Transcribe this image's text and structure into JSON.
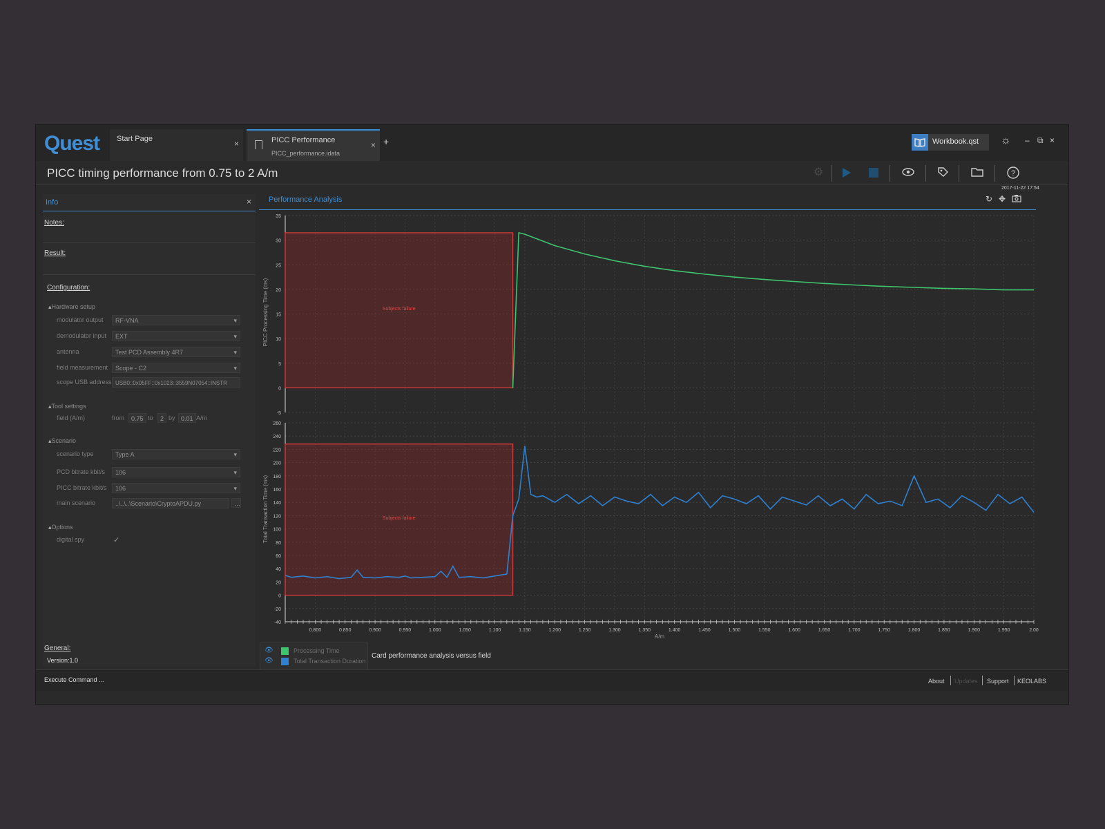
{
  "app": {
    "logo": "Quest",
    "tabs": [
      {
        "title": "Start Page",
        "subtitle": ""
      },
      {
        "title": "PICC Performance",
        "subtitle": "PICC_performance.idata"
      }
    ],
    "add_tab": "+",
    "workbook": "Workbook.qst",
    "window_controls": {
      "minimize": "–",
      "maximize": "⧉",
      "close": "×"
    },
    "close_glyph": "×"
  },
  "title": "PICC timing performance from 0.75 to 2 A/m",
  "toolbar_icons": [
    "settings-icon",
    "play-icon",
    "stop-icon",
    "eye-icon",
    "tag-icon",
    "folder-icon",
    "help-icon"
  ],
  "info": {
    "title": "Info",
    "notes": "Notes:",
    "result": "Result:",
    "configuration": "Configuration:",
    "hardware_setup": "Hardware setup",
    "modulator_output_label": "modulator output",
    "modulator_output": "RF-VNA",
    "demodulator_input_label": "demodulator input",
    "demodulator_input": "EXT",
    "antenna_label": "antenna",
    "antenna": "Test PCD Assembly 4R7",
    "field_measurement_label": "field measurement",
    "field_measurement": "Scope - C2",
    "scope_usb_label": "scope USB address",
    "scope_usb": "USB0::0x05FF::0x1023::3559N07054::INSTR",
    "tool_settings": "Tool settings",
    "field_label": "field (A/m)",
    "from_label": "from",
    "from": "0.75",
    "to_label": "to",
    "to": "2",
    "by_label": "by",
    "by": "0.01",
    "unit": "A/m",
    "scenario": "Scenario",
    "scenario_type_label": "scenario type",
    "scenario_type": "Type A",
    "pcd_bitrate_label": "PCD bitrate kbit/s",
    "pcd_bitrate": "106",
    "picc_bitrate_label": "PICC bitrate kbit/s",
    "picc_bitrate": "106",
    "main_scenario_label": "main scenario",
    "main_scenario": "..\\..\\..\\Scenario\\CryptoAPDU.py",
    "options": "Options",
    "digital_spy_label": "digital spy",
    "digital_spy_check": "✓",
    "general": "General:",
    "version": "Version:1.0"
  },
  "analysis": {
    "title": "Performance Analysis",
    "timestamp": "2017-11-22 17:54",
    "icons": [
      "refresh-icon",
      "fit-icon",
      "camera-icon"
    ],
    "caption": "Card performance analysis versus field",
    "legend": [
      {
        "label": "Processing Time",
        "color": "#3ec46d"
      },
      {
        "label": "Total Transaction Duration",
        "color": "#2f80d0"
      }
    ]
  },
  "chart_data": [
    {
      "type": "line",
      "ylabel": "PICC Processing Time (ms)",
      "ylim": [
        -5,
        35
      ],
      "yticks": [
        35,
        30,
        25,
        20,
        15,
        10,
        5,
        0,
        -5
      ],
      "region": {
        "x": [
          0.75,
          1.13
        ],
        "y": [
          0,
          31.5
        ],
        "label": "Subjects failure",
        "color": "#d13b3b"
      },
      "series": [
        {
          "name": "Processing Time",
          "color": "#3ec46d",
          "x": [
            1.13,
            1.14,
            1.15,
            1.2,
            1.25,
            1.3,
            1.35,
            1.4,
            1.45,
            1.5,
            1.55,
            1.6,
            1.65,
            1.7,
            1.75,
            1.8,
            1.85,
            1.9,
            1.95,
            2.0
          ],
          "y": [
            0,
            31.5,
            31.2,
            28.9,
            27.2,
            25.8,
            24.7,
            23.8,
            23.1,
            22.5,
            22.0,
            21.6,
            21.2,
            20.9,
            20.6,
            20.4,
            20.2,
            20.1,
            19.9,
            19.9
          ]
        }
      ]
    },
    {
      "type": "line",
      "xlabel": "A/m",
      "ylabel": "Total Transaction Time (ms)",
      "ylim": [
        -40,
        260
      ],
      "yticks": [
        260,
        240,
        220,
        200,
        180,
        160,
        140,
        120,
        100,
        80,
        60,
        40,
        20,
        0,
        -20,
        -40
      ],
      "xlim": [
        0.75,
        2.0
      ],
      "xticks": [
        "0.800",
        "0.850",
        "0.900",
        "0.950",
        "1.000",
        "1.050",
        "1.100",
        "1.150",
        "1.200",
        "1.250",
        "1.300",
        "1.350",
        "1.400",
        "1.450",
        "1.500",
        "1.550",
        "1.600",
        "1.650",
        "1.700",
        "1.750",
        "1.800",
        "1.850",
        "1.900",
        "1.950",
        "2.00"
      ],
      "region": {
        "x": [
          0.75,
          1.13
        ],
        "y": [
          0,
          228
        ],
        "label": "Subjects failure",
        "color": "#d13b3b"
      },
      "series": [
        {
          "name": "Total Transaction Duration",
          "color": "#2f80d0",
          "x": [
            0.75,
            0.76,
            0.78,
            0.8,
            0.82,
            0.84,
            0.86,
            0.87,
            0.88,
            0.9,
            0.92,
            0.94,
            0.95,
            0.96,
            0.98,
            1.0,
            1.01,
            1.02,
            1.03,
            1.04,
            1.06,
            1.08,
            1.1,
            1.12,
            1.13,
            1.14,
            1.15,
            1.16,
            1.17,
            1.18,
            1.2,
            1.22,
            1.24,
            1.26,
            1.28,
            1.3,
            1.32,
            1.34,
            1.36,
            1.38,
            1.4,
            1.42,
            1.44,
            1.46,
            1.48,
            1.5,
            1.52,
            1.54,
            1.56,
            1.58,
            1.6,
            1.62,
            1.64,
            1.66,
            1.68,
            1.7,
            1.72,
            1.74,
            1.76,
            1.78,
            1.8,
            1.82,
            1.84,
            1.86,
            1.88,
            1.9,
            1.92,
            1.94,
            1.96,
            1.98,
            2.0
          ],
          "y": [
            30,
            27,
            29,
            26,
            28,
            25,
            27,
            38,
            27,
            26,
            28,
            27,
            29,
            26,
            27,
            28,
            36,
            27,
            44,
            27,
            28,
            26,
            29,
            32,
            120,
            145,
            225,
            152,
            148,
            150,
            140,
            152,
            138,
            150,
            135,
            148,
            142,
            138,
            152,
            135,
            148,
            140,
            155,
            132,
            150,
            145,
            138,
            150,
            130,
            148,
            142,
            136,
            150,
            135,
            145,
            130,
            152,
            138,
            142,
            135,
            180,
            140,
            145,
            132,
            150,
            140,
            128,
            152,
            138,
            148,
            125
          ]
        }
      ]
    }
  ]
}
